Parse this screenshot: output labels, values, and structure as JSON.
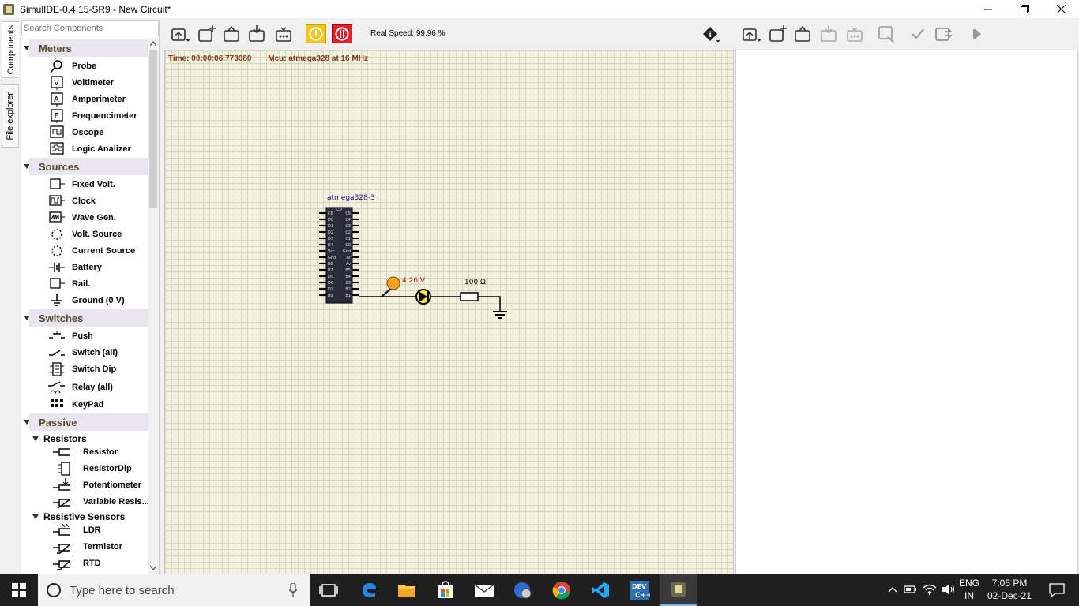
{
  "window": {
    "title": "SimulIDE-0.4.15-SR9  -  New Circuit*"
  },
  "side_tabs": [
    "Components",
    "File explorer"
  ],
  "search": {
    "placeholder": "Search Components"
  },
  "tree": {
    "categories": [
      {
        "label": "Meters",
        "items": [
          "Probe",
          "Voltimeter",
          "Amperimeter",
          "Frequencimeter",
          "Oscope",
          "Logic Analizer"
        ]
      },
      {
        "label": "Sources",
        "items": [
          "Fixed Volt.",
          "Clock",
          "Wave Gen.",
          "Volt. Source",
          "Current Source",
          "Battery",
          "Rail.",
          "Ground (0 V)"
        ]
      },
      {
        "label": "Switches",
        "items": [
          "Push",
          "Switch (all)",
          "Switch Dip",
          "Relay (all)",
          "KeyPad"
        ]
      },
      {
        "label": "Passive",
        "subcategories": [
          {
            "label": "Resistors",
            "items": [
              "Resistor",
              "ResistorDip",
              "Potentiometer",
              "Variable Resis..."
            ]
          },
          {
            "label": "Resistive Sensors",
            "items": [
              "LDR",
              "Termistor",
              "RTD"
            ]
          }
        ]
      }
    ]
  },
  "toolbar": {
    "real_speed": "Real Speed: 99.96 %"
  },
  "canvas": {
    "time": "Time: 00:00:06.773080",
    "mcu": "Mcu: atmega328 at 16 MHz",
    "chip_name": "atmega328-3",
    "left_pins": [
      "C6",
      "D0",
      "D1",
      "D2",
      "D3",
      "D4",
      "Vcc",
      "Gnd",
      "B6",
      "B7",
      "D5",
      "D6",
      "D7",
      "B0"
    ],
    "right_pins": [
      "C5",
      "C4",
      "C3",
      "C2",
      "C1",
      "C0",
      "Gnd",
      "Ar",
      "Av",
      "B5",
      "B4",
      "B3",
      "B2",
      "B1"
    ],
    "probe_value": "4.26 V",
    "resistor_value": "100 Ω"
  },
  "taskbar": {
    "search_placeholder": "Type here to search",
    "lang_top": "ENG",
    "lang_bottom": "IN",
    "time": "7:05 PM",
    "date": "02-Dec-21"
  },
  "colors": {
    "canvas_bg": "#f4f2dc",
    "status_text": "#7a3b1a",
    "category_bg": "#e8e4f0",
    "category_text": "#5a4a2a",
    "pause_button": "#f5c518",
    "power_button": "#e0202a",
    "probe": "#f7a21b",
    "taskbar": "#1f1f1f"
  }
}
